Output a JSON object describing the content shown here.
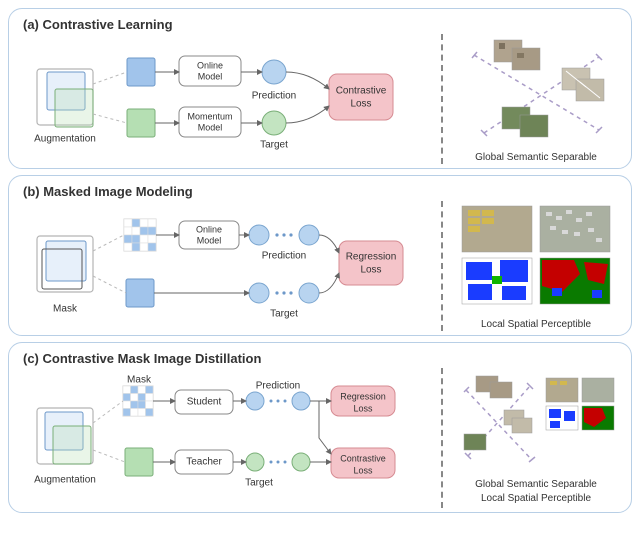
{
  "panels": {
    "a": {
      "title": "(a) Contrastive Learning",
      "augmentation": "Augmentation",
      "online_model": "Online\nModel",
      "momentum_model": "Momentum\nModel",
      "prediction": "Prediction",
      "target": "Target",
      "loss": "Contrastive\nLoss",
      "right_caption": "Global Semantic Separable"
    },
    "b": {
      "title": "(b) Masked Image Modeling",
      "mask": "Mask",
      "online_model": "Online\nModel",
      "prediction": "Prediction",
      "target": "Target",
      "loss": "Regression\nLoss",
      "right_caption": "Local Spatial  Perceptible"
    },
    "c": {
      "title": "(c) Contrastive Mask Image Distillation",
      "mask": "Mask",
      "augmentation": "Augmentation",
      "student": "Student",
      "teacher": "Teacher",
      "prediction": "Prediction",
      "target": "Target",
      "reg_loss": "Regression\nLoss",
      "con_loss": "Contrastive\nLoss",
      "right_caption_1": "Global Semantic Separable",
      "right_caption_2": "Local Spatial Perceptible"
    }
  }
}
